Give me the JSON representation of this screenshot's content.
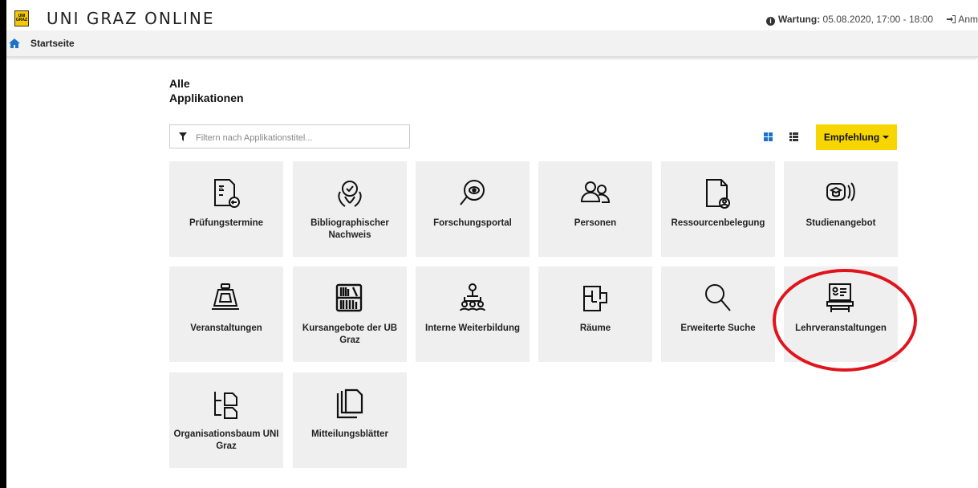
{
  "header": {
    "logo_text": "UNI GRAZ",
    "app_title": "UNI GRAZ ONLINE",
    "wartung_label": "Wartung:",
    "wartung_value": "05.08.2020, 17:00 - 18:00",
    "login_label": "Anm"
  },
  "breadcrumb": {
    "home": "Startseite"
  },
  "section": {
    "title_line1": "Alle",
    "title_line2": "Applikationen"
  },
  "filter": {
    "placeholder": "Filtern nach Applikationstitel...",
    "value": ""
  },
  "sort_button": {
    "label": "Empfehlung"
  },
  "tiles": [
    {
      "label": "Prüfungstermine",
      "icon": "exam-dates-icon"
    },
    {
      "label": "Bibliographischer Nachweis",
      "icon": "bibliography-icon"
    },
    {
      "label": "Forschungsportal",
      "icon": "research-portal-icon"
    },
    {
      "label": "Personen",
      "icon": "persons-icon"
    },
    {
      "label": "Ressourcenbelegung",
      "icon": "resource-booking-icon"
    },
    {
      "label": "Studienangebot",
      "icon": "study-programs-icon"
    },
    {
      "label": "Veranstaltungen",
      "icon": "events-icon"
    },
    {
      "label": "Kursangebote der UB Graz",
      "icon": "library-courses-icon"
    },
    {
      "label": "Interne Weiterbildung",
      "icon": "internal-training-icon"
    },
    {
      "label": "Räume",
      "icon": "rooms-icon"
    },
    {
      "label": "Erweiterte Suche",
      "icon": "search-icon"
    },
    {
      "label": "Lehrveranstaltungen",
      "icon": "courses-icon"
    },
    {
      "label": "Organisationsbaum UNI Graz",
      "icon": "org-tree-icon"
    },
    {
      "label": "Mitteilungsblätter",
      "icon": "bulletins-icon"
    }
  ],
  "colors": {
    "accent": "#f7d600",
    "annotation": "#e0141c",
    "grid_icon": "#1a73c9"
  }
}
